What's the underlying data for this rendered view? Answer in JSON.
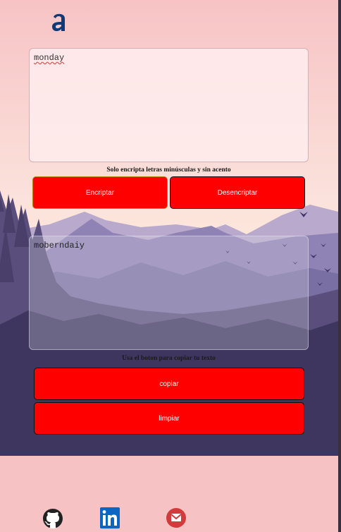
{
  "input": {
    "value": "monday"
  },
  "input_hint": "Solo encripta letras minúsculas y sin acento",
  "buttons": {
    "encrypt": "Encriptar",
    "decrypt": "Desencriptar",
    "copy": "copiar",
    "clear": "limpiar"
  },
  "output": {
    "value": "moberndaiy"
  },
  "output_hint": "Usa el boton para copiar tu texto",
  "footer": {
    "icons": [
      "github-icon",
      "linkedin-icon",
      "gmail-icon"
    ]
  },
  "colors": {
    "button": "#ff0000",
    "background": "#f6c2c4"
  }
}
